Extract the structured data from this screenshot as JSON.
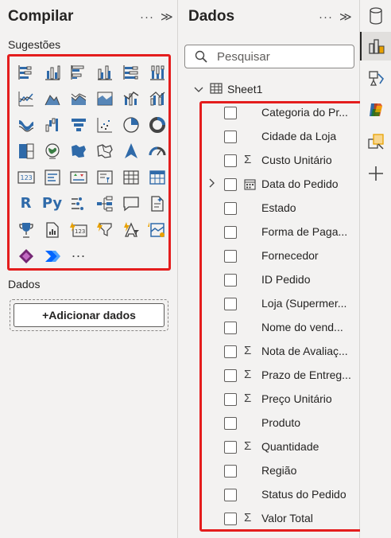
{
  "compile": {
    "title": "Compilar",
    "suggestions_label": "Sugestões",
    "more_label": "···",
    "data_label": "Dados",
    "add_data_label": "+Adicionar dados"
  },
  "data_pane": {
    "title": "Dados",
    "search_placeholder": "Pesquisar",
    "table_name": "Sheet1",
    "fields": [
      {
        "name": "Categoria do Pr...",
        "type": "text"
      },
      {
        "name": "Cidade da Loja",
        "type": "text"
      },
      {
        "name": "Custo Unitário",
        "type": "sum"
      },
      {
        "name": "Data do Pedido",
        "type": "date"
      },
      {
        "name": "Estado",
        "type": "text"
      },
      {
        "name": "Forma de Paga...",
        "type": "text"
      },
      {
        "name": "Fornecedor",
        "type": "text"
      },
      {
        "name": "ID Pedido",
        "type": "text"
      },
      {
        "name": "Loja (Supermer...",
        "type": "text"
      },
      {
        "name": "Nome do vend...",
        "type": "text"
      },
      {
        "name": "Nota de Avaliaç...",
        "type": "sum"
      },
      {
        "name": "Prazo de Entreg...",
        "type": "sum"
      },
      {
        "name": "Preço Unitário",
        "type": "sum"
      },
      {
        "name": "Produto",
        "type": "text"
      },
      {
        "name": "Quantidade",
        "type": "sum"
      },
      {
        "name": "Região",
        "type": "text"
      },
      {
        "name": "Status do Pedido",
        "type": "text"
      },
      {
        "name": "Valor Total",
        "type": "sum"
      }
    ]
  },
  "visual_text": {
    "r": "R",
    "py": "Py"
  },
  "colors": {
    "accent": "#2f6aa9",
    "highlight": "#e41d1d",
    "chart_teal": "#118dff"
  }
}
